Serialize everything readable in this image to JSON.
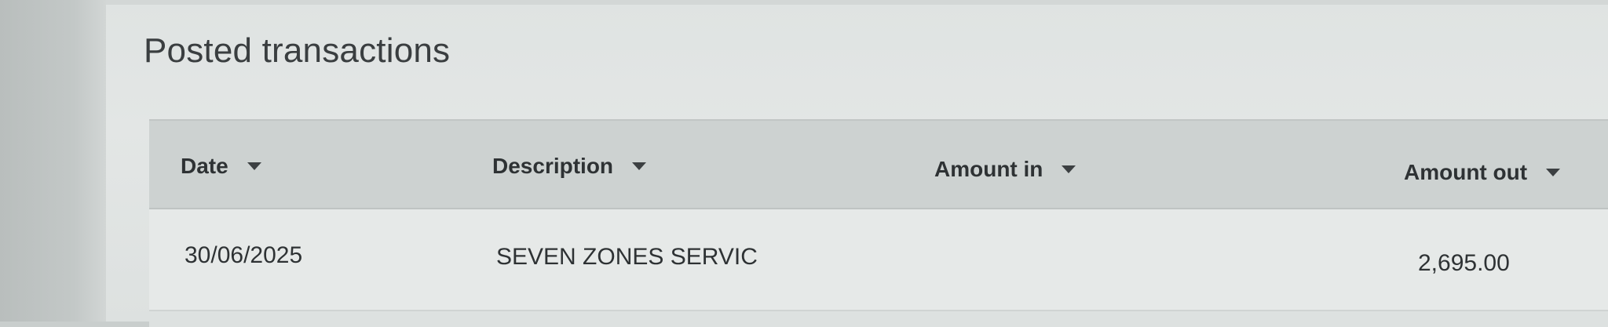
{
  "page": {
    "section_title": "Posted transactions"
  },
  "table": {
    "columns": [
      {
        "label": "Date"
      },
      {
        "label": "Description"
      },
      {
        "label": "Amount in"
      },
      {
        "label": "Amount out"
      }
    ],
    "rows": [
      {
        "date": "30/06/2025",
        "description": "SEVEN ZONES SERVIC",
        "amount_in": "",
        "amount_out": "2,695.00"
      }
    ]
  },
  "icons": {
    "sort": "caret-down-icon"
  },
  "colors": {
    "header_bg": "#cdd2d1",
    "row_bg": "#e6e9e8",
    "text": "#2e3234"
  }
}
